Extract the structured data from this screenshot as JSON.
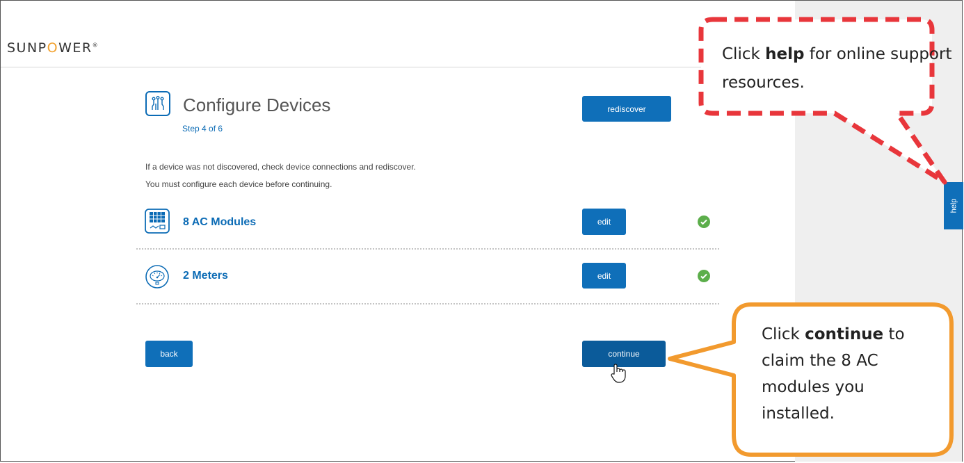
{
  "brand": {
    "logo_pre": "SUNP",
    "logo_o": "O",
    "logo_post": "WER"
  },
  "page": {
    "title": "Configure Devices",
    "step": "Step 4 of 6",
    "instructions": [
      "If a device was not discovered, check device connections and rediscover.",
      "You must configure each device before continuing."
    ]
  },
  "buttons": {
    "rediscover": "rediscover",
    "edit": "edit",
    "back": "back",
    "continue": "continue",
    "help": "help"
  },
  "devices": [
    {
      "label": "8 AC Modules",
      "status": "configured"
    },
    {
      "label": "2 Meters",
      "status": "configured"
    }
  ],
  "callouts": {
    "help": {
      "pre": "Click ",
      "bold": "help",
      "post": " for online support resources."
    },
    "continue": {
      "pre": "Click ",
      "bold": "continue",
      "post": " to claim the 8 AC modules you installed."
    }
  },
  "colors": {
    "primary": "#0f6fb9",
    "success": "#5cae4b",
    "help_callout": "#e8363b",
    "continue_callout": "#f29a2e"
  },
  "icons": {
    "title": "circuit-icon",
    "modules": "solar-panel-icon",
    "meters": "meter-gauge-icon",
    "status": "checkmark-icon",
    "cursor": "hand-pointer-icon"
  }
}
